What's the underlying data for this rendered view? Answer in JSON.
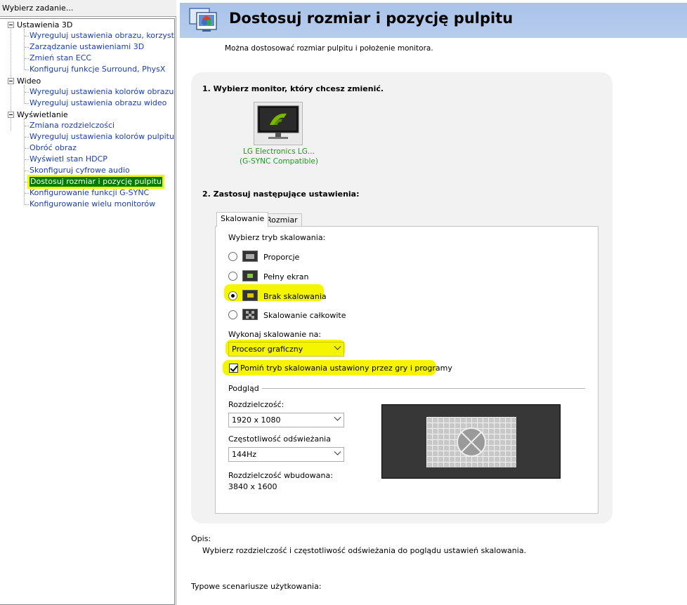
{
  "left_panel": {
    "header": "Wybierz zadanie...",
    "groups": [
      {
        "label": "Ustawienia 3D",
        "items": [
          "Wyreguluj ustawienia obrazu, korzystając z",
          "Zarządzanie ustawieniami 3D",
          "Zmień stan ECC",
          "Konfiguruj funkcje Surround, PhysX"
        ]
      },
      {
        "label": "Wideo",
        "items": [
          "Wyreguluj ustawienia kolorów obrazu wideo",
          "Wyreguluj ustawienia obrazu wideo"
        ]
      },
      {
        "label": "Wyświetlanie",
        "items": [
          "Zmiana rozdzielczości",
          "Wyreguluj ustawienia kolorów pulpitu",
          "Obróć obraz",
          "Wyświetl stan HDCP",
          "Skonfiguruj cyfrowe audio",
          "Dostosuj rozmiar i pozycję pulpitu",
          "Konfigurowanie funkcji G-SYNC",
          "Konfigurowanie wielu monitorów"
        ],
        "selected_index": 5
      }
    ]
  },
  "page": {
    "title": "Dostosuj rozmiar i pozycję pulpitu",
    "subtitle": "Można dostosować rozmiar pulpitu i położenie monitora.",
    "section1": "1. Wybierz monitor, który chcesz zmienić.",
    "monitor_name": "LG Electronics LG...",
    "monitor_sub": "(G-SYNC Compatible)",
    "section2": "2. Zastosuj następujące ustawienia:"
  },
  "tabs": [
    "Skalowanie",
    "Rozmiar"
  ],
  "scaling": {
    "mode_label": "Wybierz tryb skalowania:",
    "modes": [
      "Proporcje",
      "Pełny ekran",
      "Brak skalowania",
      "Skalowanie całkowite"
    ],
    "selected_mode": "Brak skalowania",
    "perform_on_label": "Wykonaj skalowanie na:",
    "perform_on_value": "Procesor graficzny",
    "override_label": "Pomiń tryb skalowania ustawiony przez gry i programy",
    "override_checked": true
  },
  "preview": {
    "group_label": "Podgląd",
    "resolution_label": "Rozdzielczość:",
    "resolution_value": "1920 x 1080",
    "refresh_label": "Częstotliwość odświeżania",
    "refresh_value": "144Hz",
    "native_label": "Rozdzielczość wbudowana:",
    "native_value": "3840 x 1600"
  },
  "description": {
    "label": "Opis:",
    "text": "Wybierz rozdzielczość i częstotliwość odświeżania do poglądu ustawień skalowania.",
    "scenarios_label": "Typowe scenariusze użytkowania:"
  }
}
